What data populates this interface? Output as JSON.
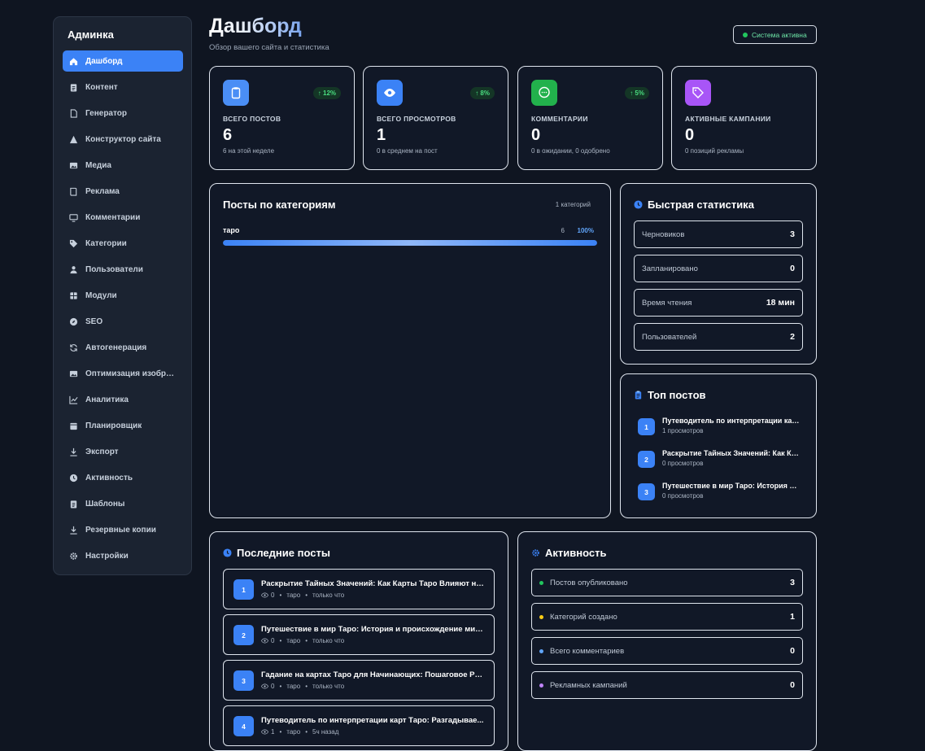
{
  "sidebar": {
    "brand": "Админка",
    "items": [
      {
        "label": "Дашборд",
        "icon": "home-icon",
        "active": true
      },
      {
        "label": "Контент",
        "icon": "clipboard-icon"
      },
      {
        "label": "Генератор",
        "icon": "document-icon"
      },
      {
        "label": "Конструктор сайта",
        "icon": "triangle-icon"
      },
      {
        "label": "Медиа",
        "icon": "image-icon"
      },
      {
        "label": "Реклама",
        "icon": "book-icon"
      },
      {
        "label": "Комментарии",
        "icon": "monitor-icon"
      },
      {
        "label": "Категории",
        "icon": "tag-icon"
      },
      {
        "label": "Пользователи",
        "icon": "user-icon"
      },
      {
        "label": "Модули",
        "icon": "grid-icon"
      },
      {
        "label": "SEO",
        "icon": "compass-icon"
      },
      {
        "label": "Автогенерация",
        "icon": "refresh-icon"
      },
      {
        "label": "Оптимизация изображений",
        "icon": "image-icon"
      },
      {
        "label": "Аналитика",
        "icon": "chart-icon"
      },
      {
        "label": "Планировщик",
        "icon": "calendar-icon"
      },
      {
        "label": "Экспорт",
        "icon": "download-icon"
      },
      {
        "label": "Активность",
        "icon": "clock-icon"
      },
      {
        "label": "Шаблоны",
        "icon": "clipboard-icon"
      },
      {
        "label": "Резервные копии",
        "icon": "download-icon"
      },
      {
        "label": "Настройки",
        "icon": "gear-icon"
      }
    ]
  },
  "header": {
    "title": "Дашборд",
    "subtitle": "Обзор вашего сайта и статистика",
    "status": "Система активна"
  },
  "stats": [
    {
      "label": "ВСЕГО ПОСТОВ",
      "value": "6",
      "note": "6 на этой неделе",
      "trend": "↑ 12%",
      "icon": "clipboard-icon",
      "color": "#4a8ef5"
    },
    {
      "label": "ВСЕГО ПРОСМОТРОВ",
      "value": "1",
      "note": "0 в среднем на пост",
      "trend": "↑ 8%",
      "icon": "eye-icon",
      "color": "#3b82f6"
    },
    {
      "label": "КОММЕНТАРИИ",
      "value": "0",
      "note": "0 в ожидании, 0 одобрено",
      "trend": "↑ 5%",
      "icon": "chat-icon",
      "color": "#22b14c"
    },
    {
      "label": "АКТИВНЫЕ КАМПАНИИ",
      "value": "0",
      "note": "0 позиций рекламы",
      "trend": "",
      "icon": "tag-icon",
      "color": "#a855f7"
    }
  ],
  "categories": {
    "title": "Посты по категориям",
    "count_label": "1 категорий",
    "items": [
      {
        "name": "таро",
        "count": "6",
        "percent": "100%",
        "fraction": 1.0
      }
    ]
  },
  "quick_stats": {
    "title": "Быстрая статистика",
    "rows": [
      {
        "label": "Черновиков",
        "value": "3"
      },
      {
        "label": "Запланировано",
        "value": "0"
      },
      {
        "label": "Время чтения",
        "value": "18 мин"
      },
      {
        "label": "Пользователей",
        "value": "2"
      }
    ]
  },
  "top_posts": {
    "title": "Топ постов",
    "items": [
      {
        "n": "1",
        "title": "Путеводитель по интерпретации карт Таро: Разгадывае...",
        "meta": "1 просмотров"
      },
      {
        "n": "2",
        "title": "Раскрытие Тайных Значений: Как Карты Таро Влияют н...",
        "meta": "0 просмотров"
      },
      {
        "n": "3",
        "title": "Путешествие в мир Таро: История и происхождение ми...",
        "meta": "0 просмотров"
      }
    ]
  },
  "recent_posts": {
    "title": "Последние посты",
    "items": [
      {
        "n": "1",
        "title": "Раскрытие Тайных Значений: Как Карты Таро Влияют на...",
        "views": "0",
        "category": "таро",
        "time": "только что"
      },
      {
        "n": "2",
        "title": "Путешествие в мир Таро: История и происхождение мистических карт",
        "views": "0",
        "category": "таро",
        "time": "только что"
      },
      {
        "n": "3",
        "title": "Гадание на картах Таро для Начинающих: Пошаговое Руководство",
        "views": "0",
        "category": "таро",
        "time": "только что"
      },
      {
        "n": "4",
        "title": "Путеводитель по интерпретации карт Таро: Разгадывае...",
        "views": "1",
        "category": "таро",
        "time": "5ч назад"
      }
    ]
  },
  "activity": {
    "title": "Активность",
    "rows": [
      {
        "label": "Постов опубликовано",
        "value": "3",
        "color": "#22c55e"
      },
      {
        "label": "Категорий создано",
        "value": "1",
        "color": "#facc15"
      },
      {
        "label": "Всего комментариев",
        "value": "0",
        "color": "#60a5fa"
      },
      {
        "label": "Рекламных кампаний",
        "value": "0",
        "color": "#c084fc"
      }
    ]
  },
  "colors": {
    "accent": "#3b82f6",
    "background": "#0f1521",
    "panel": "#111827"
  }
}
